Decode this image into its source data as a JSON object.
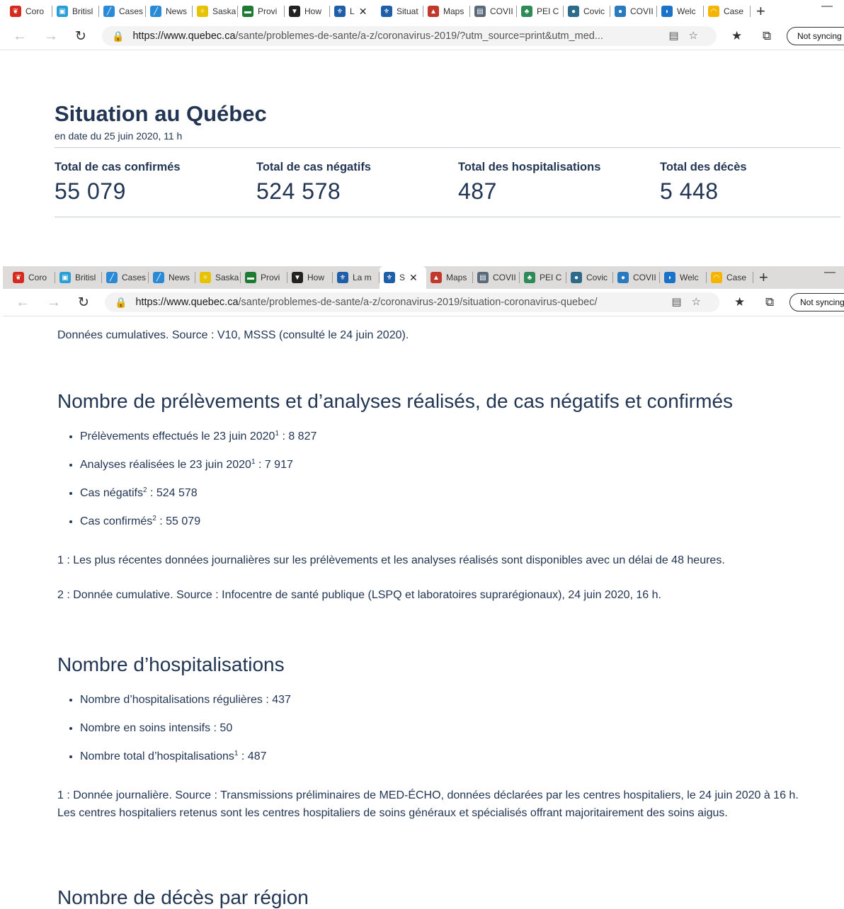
{
  "browser1": {
    "tabs": [
      {
        "label": "Coro",
        "color": "#d52b1e",
        "glyph": "❦"
      },
      {
        "label": "Britisl",
        "color": "#2a9fd6",
        "glyph": "▣"
      },
      {
        "label": "Cases",
        "color": "#2a8ad6",
        "glyph": "╱"
      },
      {
        "label": "News",
        "color": "#2a8ad6",
        "glyph": "╱"
      },
      {
        "label": "Saska",
        "color": "#e6c200",
        "glyph": "✧"
      },
      {
        "label": "Provi",
        "color": "#1e7b34",
        "glyph": "▬"
      },
      {
        "label": "How",
        "color": "#222222",
        "glyph": "▼"
      },
      {
        "label": "L",
        "color": "#1f5ea8",
        "glyph": "⚜"
      },
      {
        "label": "Situat",
        "color": "#1f5ea8",
        "glyph": "⚜"
      },
      {
        "label": "Maps",
        "color": "#c0392b",
        "glyph": "▲"
      },
      {
        "label": "COVII",
        "color": "#5a6a7a",
        "glyph": "▤"
      },
      {
        "label": "PEI C",
        "color": "#2e8b57",
        "glyph": "♣"
      },
      {
        "label": "Covic",
        "color": "#2e6b8a",
        "glyph": "●"
      },
      {
        "label": "COVII",
        "color": "#2a7ac0",
        "glyph": "●"
      },
      {
        "label": "Welc",
        "color": "#1a73c8",
        "glyph": "◗"
      },
      {
        "label": "Case",
        "color": "#f4b400",
        "glyph": "◠"
      }
    ],
    "url_host": "https://www.quebec.ca",
    "url_path": "/sante/problemes-de-sante/a-z/coronavirus-2019/?utm_source=print&utm_med...",
    "not_syncing": "Not syncing"
  },
  "browser2": {
    "tabs": [
      {
        "label": "Coro",
        "color": "#d52b1e",
        "glyph": "❦"
      },
      {
        "label": "Britisl",
        "color": "#2a9fd6",
        "glyph": "▣"
      },
      {
        "label": "Cases",
        "color": "#2a8ad6",
        "glyph": "╱"
      },
      {
        "label": "News",
        "color": "#2a8ad6",
        "glyph": "╱"
      },
      {
        "label": "Saska",
        "color": "#e6c200",
        "glyph": "✧"
      },
      {
        "label": "Provi",
        "color": "#1e7b34",
        "glyph": "▬"
      },
      {
        "label": "How",
        "color": "#222222",
        "glyph": "▼"
      },
      {
        "label": "La m",
        "color": "#1f5ea8",
        "glyph": "⚜"
      },
      {
        "label": "S",
        "color": "#1f5ea8",
        "glyph": "⚜"
      },
      {
        "label": "Maps",
        "color": "#c0392b",
        "glyph": "▲"
      },
      {
        "label": "COVII",
        "color": "#5a6a7a",
        "glyph": "▤"
      },
      {
        "label": "PEI C",
        "color": "#2e8b57",
        "glyph": "♣"
      },
      {
        "label": "Covic",
        "color": "#2e6b8a",
        "glyph": "●"
      },
      {
        "label": "COVII",
        "color": "#2a7ac0",
        "glyph": "●"
      },
      {
        "label": "Welc",
        "color": "#1a73c8",
        "glyph": "◗"
      },
      {
        "label": "Case",
        "color": "#f4b400",
        "glyph": "◠"
      }
    ],
    "url_host": "https://www.quebec.ca",
    "url_path": "/sante/problemes-de-sante/a-z/coronavirus-2019/situation-coronavirus-quebec/",
    "not_syncing": "Not syncing"
  },
  "situation": {
    "title": "Situation au Québec",
    "date": "en date du 25 juin 2020, 11 h",
    "stats": [
      {
        "label": "Total de cas confirmés",
        "value": "55 079"
      },
      {
        "label": "Total de cas négatifs",
        "value": "524 578"
      },
      {
        "label": "Total des hospitalisations",
        "value": "487"
      },
      {
        "label": "Total des décès",
        "value": "5 448"
      }
    ]
  },
  "details": {
    "cumulative_note": "Données cumulatives. Source : V10, MSSS (consulté le 24 juin 2020).",
    "tests_heading": "Nombre de prélèvements et d’analyses réalisés, de cas négatifs et confirmés",
    "tests_items": [
      {
        "text": "Prélèvements effectués le 23 juin 2020",
        "sup": "1",
        "value": " : 8 827"
      },
      {
        "text": "Analyses réalisées le 23 juin 2020",
        "sup": "1",
        "value": " : 7 917"
      },
      {
        "text": "Cas négatifs",
        "sup": "2",
        "value": " : 524 578"
      },
      {
        "text": "Cas confirmés",
        "sup": "2",
        "value": " : 55 079"
      }
    ],
    "tests_note1": "1 : Les plus récentes données journalières sur les prélèvements et les analyses réalisés sont disponibles avec un délai de 48 heures.",
    "tests_note2": "2 : Donnée cumulative. Source : Infocentre de santé publique (LSPQ et laboratoires suprarégionaux), 24 juin 2020, 16 h.",
    "hosp_heading": "Nombre d’hospitalisations",
    "hosp_items": [
      {
        "text": "Nombre d’hospitalisations régulières",
        "sup": "",
        "value": " : 437"
      },
      {
        "text": "Nombre en soins intensifs",
        "sup": "",
        "value": " : 50"
      },
      {
        "text": "Nombre total d’hospitalisations",
        "sup": "1",
        "value": " : 487"
      }
    ],
    "hosp_note_line1": "1 : Donnée journalière. Source : Transmissions préliminaires de MED-ÉCHO, données déclarées par les centres hospitaliers, le 24 juin 2020 à 16 h.",
    "hosp_note_line2": "Les centres hospitaliers retenus sont les centres hospitaliers de soins généraux et spécialisés offrant majoritairement des soins aigus.",
    "deaths_heading": "Nombre de décès par région"
  }
}
